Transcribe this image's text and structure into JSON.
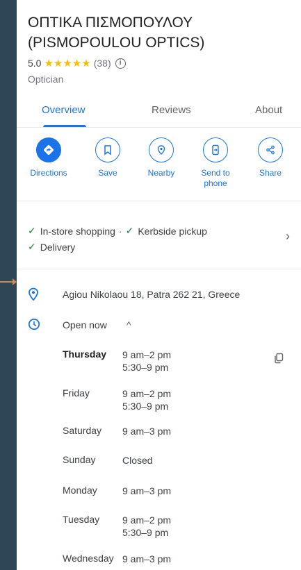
{
  "place": {
    "title": "ΟΠΤΙΚΑ ΠΙΣΜΟΠΟΥΛΟΥ (PISMOPOULOU OPTICS)",
    "rating": "5.0",
    "stars": "★★★★★",
    "review_count": "(38)",
    "category": "Optician"
  },
  "tabs": [
    {
      "label": "Overview"
    },
    {
      "label": "Reviews"
    },
    {
      "label": "About"
    }
  ],
  "actions": [
    {
      "label": "Directions",
      "icon": "directions-icon"
    },
    {
      "label": "Save",
      "icon": "bookmark-icon"
    },
    {
      "label": "Nearby",
      "icon": "nearby-icon"
    },
    {
      "label": "Send to phone",
      "icon": "send-to-phone-icon"
    },
    {
      "label": "Share",
      "icon": "share-icon"
    }
  ],
  "services": {
    "line1a": "In-store shopping",
    "separator": "·",
    "line1b": "Kerbside pickup",
    "line2": "Delivery"
  },
  "address": "Agiou Nikolaou 18, Patra 262 21, Greece",
  "open_status": "Open now",
  "hours": [
    {
      "day": "Thursday",
      "t1": "9 am–2 pm",
      "t2": "5:30–9 pm"
    },
    {
      "day": "Friday",
      "t1": "9 am–2 pm",
      "t2": "5:30–9 pm"
    },
    {
      "day": "Saturday",
      "t1": "9 am–3 pm",
      "t2": ""
    },
    {
      "day": "Sunday",
      "t1": "Closed",
      "t2": ""
    },
    {
      "day": "Monday",
      "t1": "9 am–3 pm",
      "t2": ""
    },
    {
      "day": "Tuesday",
      "t1": "9 am–2 pm",
      "t2": "5:30–9 pm"
    },
    {
      "day": "Wednesday",
      "t1": "9 am–3 pm",
      "t2": ""
    }
  ],
  "colors": {
    "accent": "#1a73e8",
    "star": "#fbbc04",
    "check": "#188038",
    "sidebar": "#2f4656"
  }
}
